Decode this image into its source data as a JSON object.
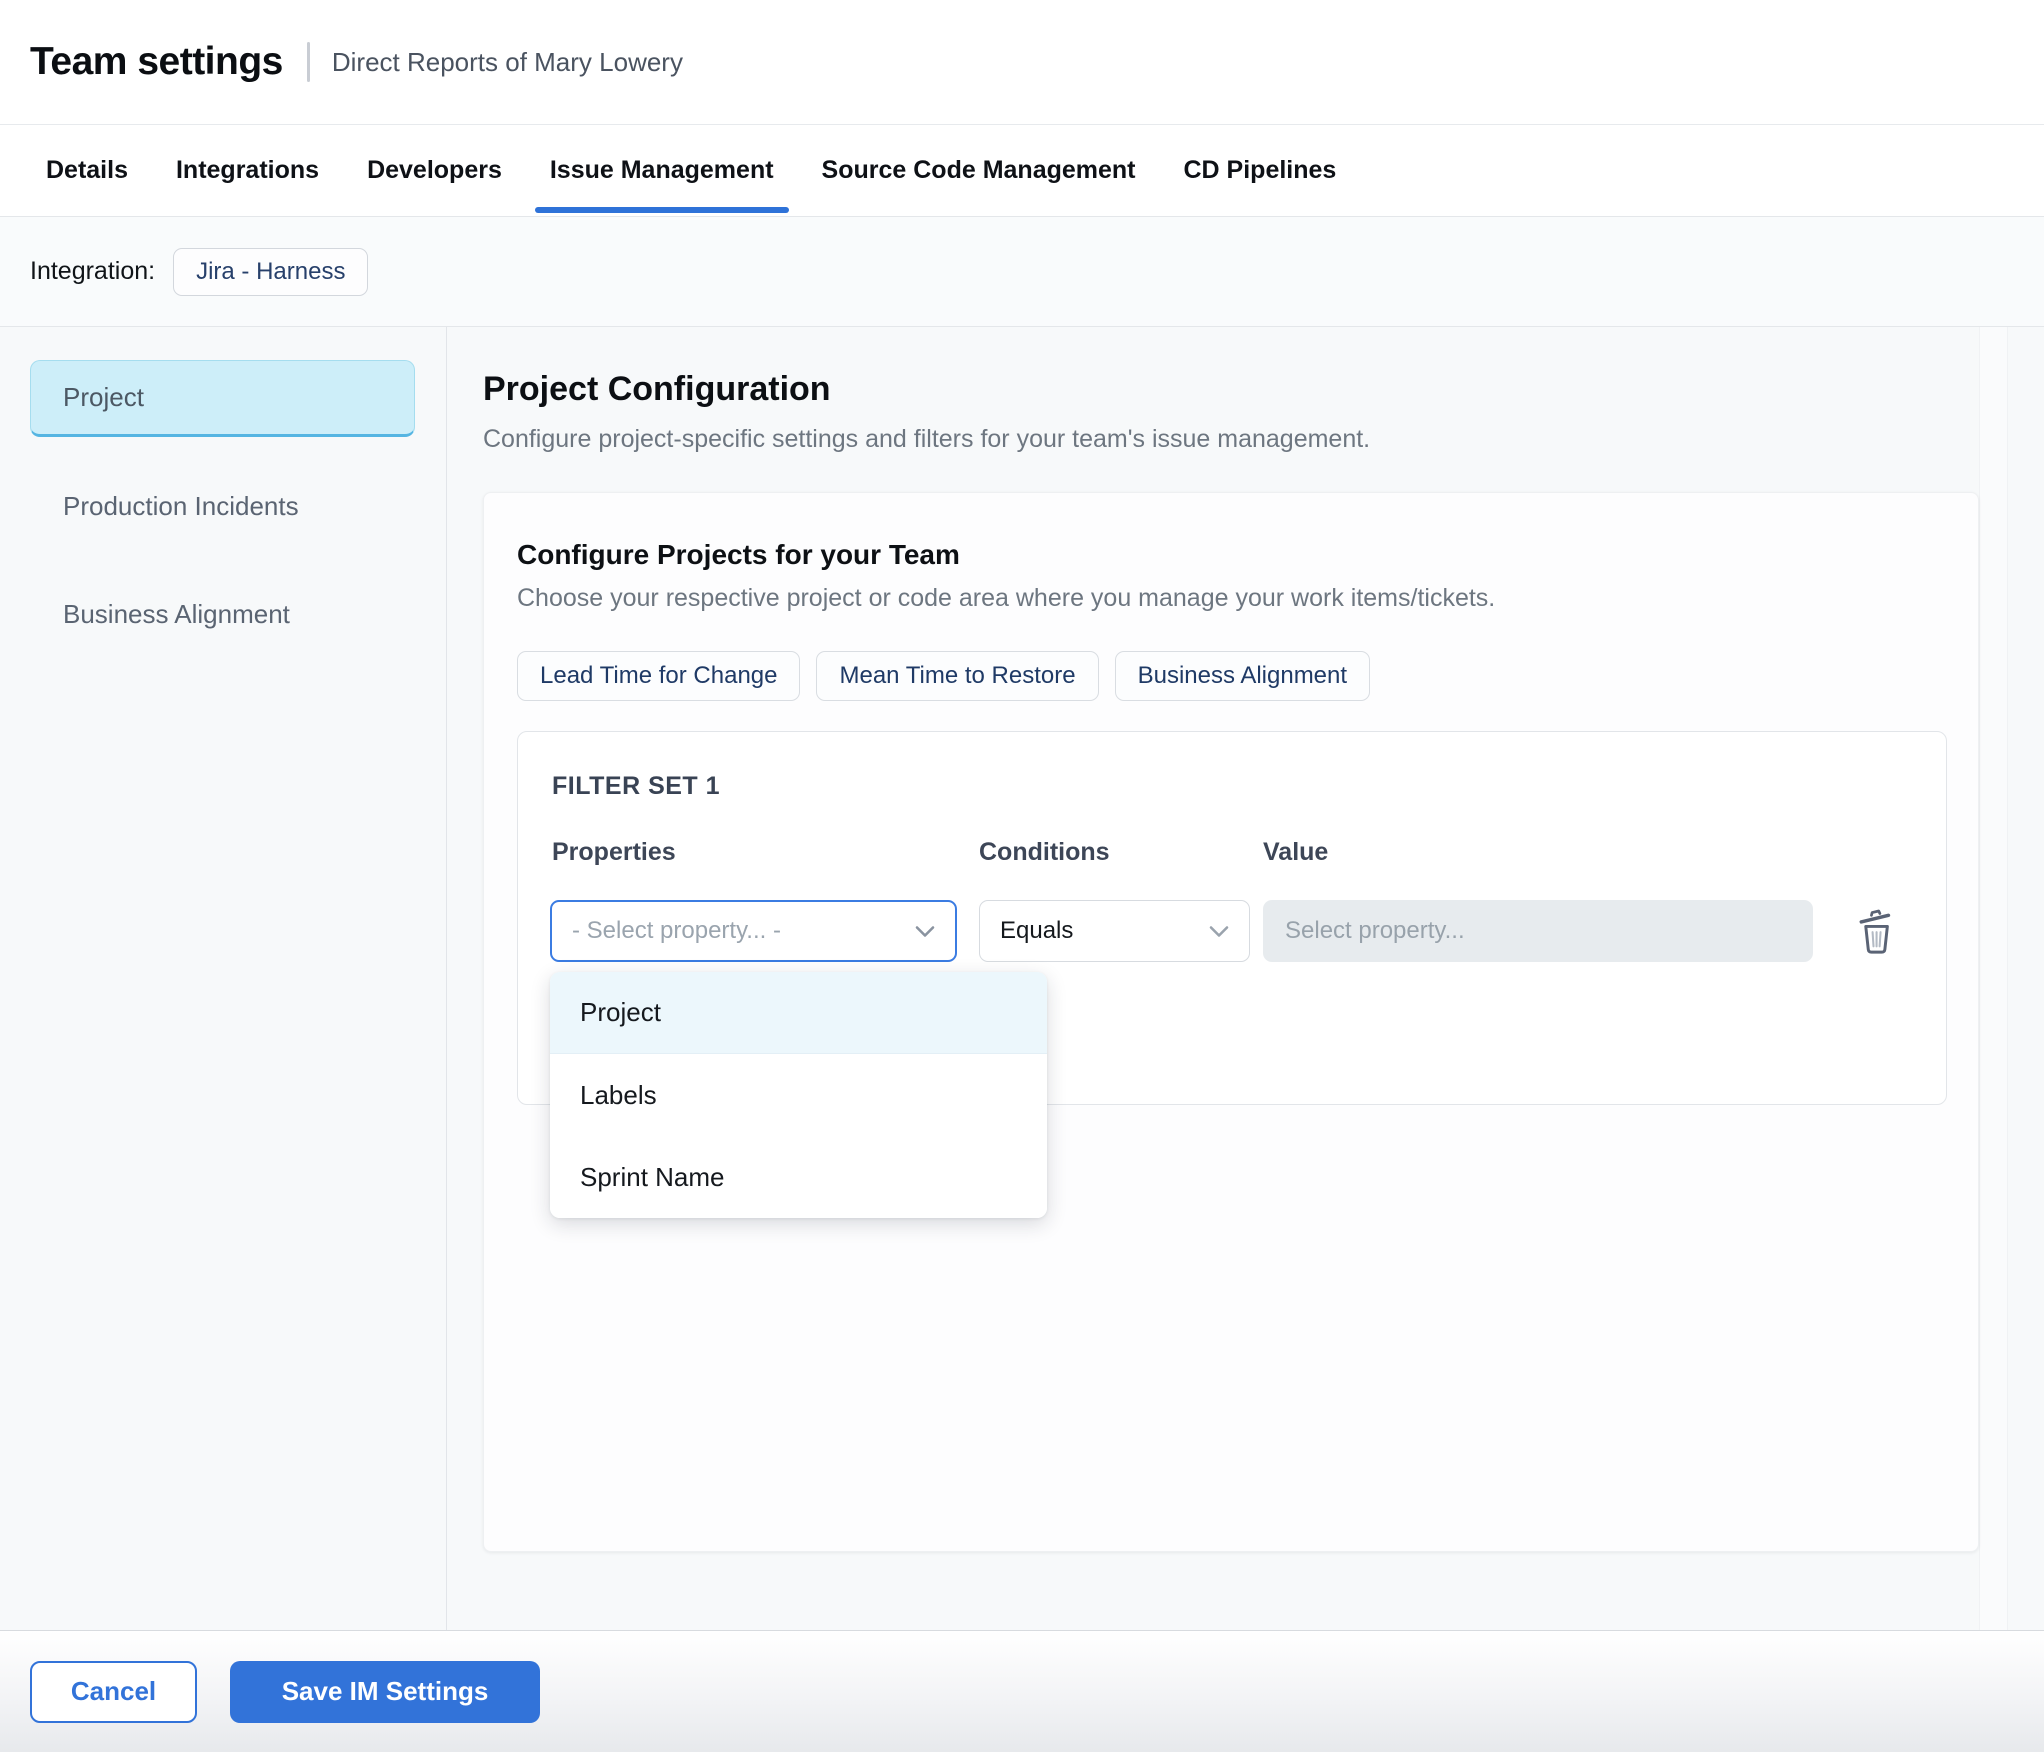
{
  "header": {
    "title": "Team settings",
    "subtitle": "Direct Reports of Mary Lowery"
  },
  "tabs": {
    "items": [
      {
        "label": "Details",
        "active": false
      },
      {
        "label": "Integrations",
        "active": false
      },
      {
        "label": "Developers",
        "active": false
      },
      {
        "label": "Issue Management",
        "active": true
      },
      {
        "label": "Source Code Management",
        "active": false
      },
      {
        "label": "CD Pipelines",
        "active": false
      }
    ]
  },
  "integration": {
    "label": "Integration:",
    "chip": "Jira - Harness"
  },
  "sidebar": {
    "items": [
      {
        "label": "Project",
        "selected": true
      },
      {
        "label": "Production Incidents",
        "selected": false
      },
      {
        "label": "Business Alignment",
        "selected": false
      }
    ]
  },
  "main": {
    "title": "Project Configuration",
    "subtitle": "Configure project-specific settings and filters for your team's issue management.",
    "card": {
      "title": "Configure Projects for your Team",
      "subtitle": "Choose your respective project or code area where you manage your work items/tickets.",
      "chips": [
        "Lead Time for Change",
        "Mean Time to Restore",
        "Business Alignment"
      ],
      "filter_set": {
        "title": "FILTER SET 1",
        "columns": {
          "properties": "Properties",
          "conditions": "Conditions",
          "value": "Value"
        },
        "properties_placeholder": "- Select property... -",
        "conditions_value": "Equals",
        "value_placeholder": "Select property...",
        "icons": {
          "trash": "trash-icon",
          "chevron": "chevron-down-icon"
        }
      },
      "dropdown": {
        "options": [
          "Project",
          "Labels",
          "Sprint Name"
        ],
        "highlighted": "Project"
      }
    }
  },
  "footer": {
    "cancel_label": "Cancel",
    "save_label": "Save IM Settings"
  },
  "colors": {
    "accent_blue": "#3273d9",
    "tab_underline": "#2e72d8",
    "selected_nav_bg": "#cdeef9",
    "selected_nav_border": "#55b5e2",
    "focus_border": "#3b7ce2",
    "highlighted_option_bg": "#ecf7fc",
    "disabled_field_bg": "#e7ebee",
    "page_bg": "#f7f9fa"
  }
}
